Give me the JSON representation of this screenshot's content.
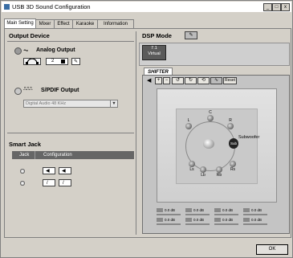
{
  "window": {
    "title": "USB 3D Sound Configuration",
    "minimize": "_",
    "maximize": "□",
    "close": "x"
  },
  "tabs": [
    "Main Setting",
    "Mixer",
    "Effect",
    "Karaoke",
    "Information"
  ],
  "output_device": {
    "heading": "Output Device",
    "analog_label": "Analog Output",
    "channel_value": "2",
    "spdif_label": "S/PDIF Output",
    "spdif_select": "Digital Audio 48 KHz",
    "spdif_select_arrow": "▼"
  },
  "smart_jack": {
    "heading": "Smart Jack",
    "columns": [
      "Jack",
      "Configuration"
    ]
  },
  "dsp": {
    "heading": "DSP Mode",
    "mode_line1": "7.1",
    "mode_line2": "Virtual",
    "shifter_tab": "SHIFTER",
    "reset_label": "Reset"
  },
  "speakers": {
    "center": "C",
    "left": "L",
    "right": "R",
    "left_side": "Ls",
    "right_side": "Rs",
    "left_back": "Lb",
    "right_back": "Rb",
    "subwoofer": "Subwoofer",
    "sub_badge": "Sub"
  },
  "levels": [
    "0.0 dB",
    "0.0 dB",
    "0.0 dB",
    "0.0 dB",
    "0.0 dB",
    "0.0 dB",
    "0.0 dB",
    "0.0 dB"
  ],
  "footer": {
    "ok_label": "OK"
  }
}
